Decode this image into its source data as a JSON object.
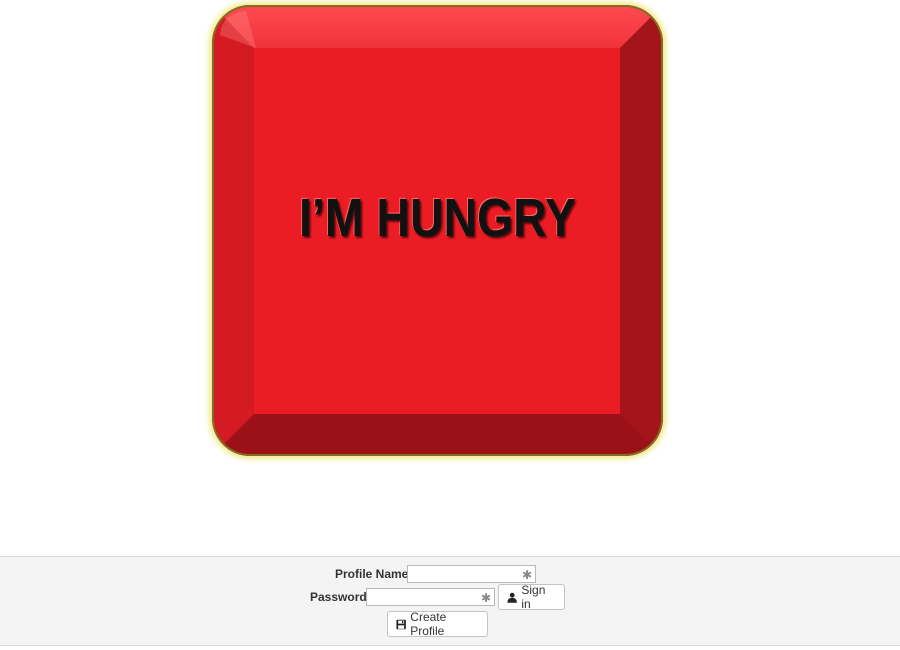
{
  "main": {
    "button_label": "I’M HUNGRY",
    "button_color": "#ec1c24"
  },
  "login": {
    "profile_name_label": "Profile Name:",
    "profile_name_value": "",
    "password_label": "Password:",
    "password_value": "",
    "required_marker": "✱",
    "sign_in_label": "Sign in",
    "create_profile_label": "Create Profile",
    "sign_in_icon": "user-icon",
    "create_profile_icon": "save-icon"
  }
}
